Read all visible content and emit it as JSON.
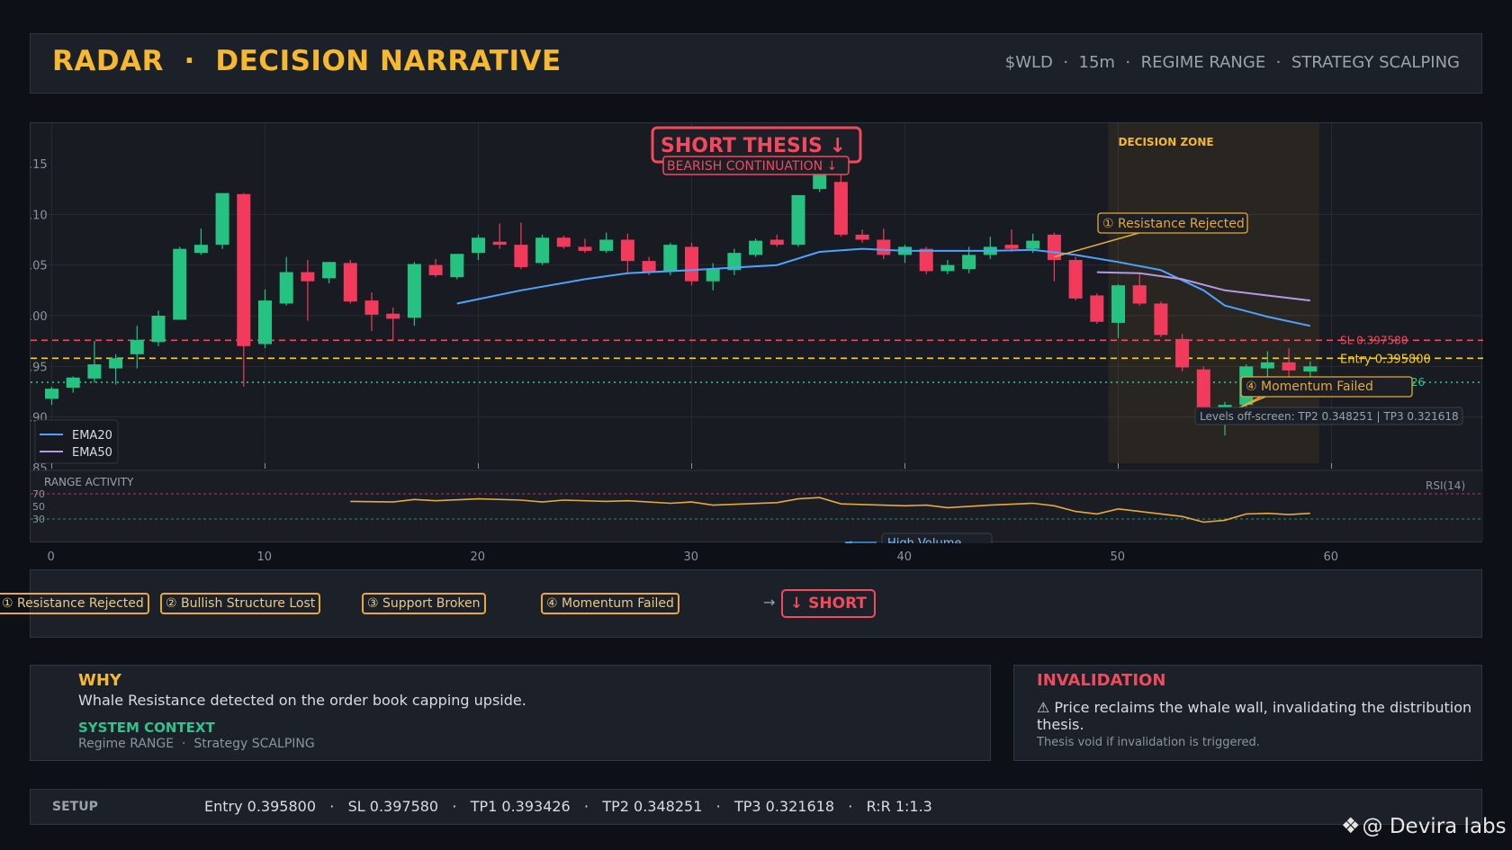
{
  "header": {
    "title": "RADAR  ·  DECISION NARRATIVE",
    "meta": "$WLD  ·  15m  ·  REGIME RANGE  ·  STRATEGY SCALPING"
  },
  "chart_data": {
    "type": "candlestick",
    "x_ticks": [
      "0",
      "10",
      "20",
      "30",
      "40",
      "50",
      "60"
    ],
    "y_ticks": [
      ".15",
      ".10",
      ".05",
      ".00",
      ".95",
      ".90",
      ".85"
    ],
    "candles": [
      [
        0.3918,
        0.3928,
        0.3912,
        0.393
      ],
      [
        0.3929,
        0.3939,
        0.3924,
        0.394
      ],
      [
        0.3938,
        0.3952,
        0.3934,
        0.3975
      ],
      [
        0.3948,
        0.3958,
        0.3932,
        0.3962
      ],
      [
        0.3962,
        0.3976,
        0.3948,
        0.399
      ],
      [
        0.3974,
        0.4,
        0.397,
        0.4005
      ],
      [
        0.3996,
        0.4066,
        0.3996,
        0.4068
      ],
      [
        0.4062,
        0.407,
        0.406,
        0.4086
      ],
      [
        0.407,
        0.4121,
        0.4066,
        0.4121
      ],
      [
        0.412,
        0.397,
        0.393,
        0.4121
      ],
      [
        0.3972,
        0.4015,
        0.3968,
        0.4026
      ],
      [
        0.4012,
        0.4043,
        0.401,
        0.4058
      ],
      [
        0.4043,
        0.4034,
        0.3995,
        0.4055
      ],
      [
        0.4037,
        0.4053,
        0.4032,
        0.4053
      ],
      [
        0.4052,
        0.4014,
        0.4012,
        0.4055
      ],
      [
        0.4015,
        0.4001,
        0.3985,
        0.4023
      ],
      [
        0.4002,
        0.3997,
        0.3975,
        0.4008
      ],
      [
        0.3998,
        0.4051,
        0.399,
        0.4053
      ],
      [
        0.405,
        0.404,
        0.4038,
        0.4056
      ],
      [
        0.4038,
        0.4061,
        0.4036,
        0.4061
      ],
      [
        0.4062,
        0.4077,
        0.4055,
        0.408
      ],
      [
        0.4073,
        0.407,
        0.4066,
        0.4091
      ],
      [
        0.407,
        0.4048,
        0.4046,
        0.4092
      ],
      [
        0.4052,
        0.4077,
        0.405,
        0.408
      ],
      [
        0.4077,
        0.4068,
        0.4066,
        0.4079
      ],
      [
        0.4068,
        0.4064,
        0.4062,
        0.4076
      ],
      [
        0.4064,
        0.4075,
        0.4062,
        0.4082
      ],
      [
        0.4075,
        0.4054,
        0.4041,
        0.4081
      ],
      [
        0.4054,
        0.4043,
        0.404,
        0.4058
      ],
      [
        0.4044,
        0.407,
        0.404,
        0.4072
      ],
      [
        0.4068,
        0.4034,
        0.403,
        0.4072
      ],
      [
        0.4034,
        0.4046,
        0.4025,
        0.4052
      ],
      [
        0.4045,
        0.4062,
        0.404,
        0.4066
      ],
      [
        0.406,
        0.4074,
        0.4058,
        0.4076
      ],
      [
        0.4075,
        0.407,
        0.4068,
        0.408
      ],
      [
        0.407,
        0.4119,
        0.4068,
        0.4119
      ],
      [
        0.4125,
        0.414,
        0.4122,
        0.415
      ],
      [
        0.4132,
        0.408,
        0.4078,
        0.4148
      ],
      [
        0.408,
        0.4075,
        0.4072,
        0.4085
      ],
      [
        0.4075,
        0.406,
        0.4056,
        0.4086
      ],
      [
        0.406,
        0.4068,
        0.4052,
        0.407
      ],
      [
        0.4066,
        0.4044,
        0.4041,
        0.4068
      ],
      [
        0.4044,
        0.405,
        0.4041,
        0.4055
      ],
      [
        0.4046,
        0.406,
        0.4042,
        0.4068
      ],
      [
        0.406,
        0.4068,
        0.4056,
        0.4078
      ],
      [
        0.407,
        0.4066,
        0.4063,
        0.4085
      ],
      [
        0.4066,
        0.4074,
        0.4062,
        0.4081
      ],
      [
        0.408,
        0.4055,
        0.4034,
        0.4082
      ],
      [
        0.4055,
        0.4017,
        0.4015,
        0.4058
      ],
      [
        0.402,
        0.3994,
        0.3992,
        0.4022
      ],
      [
        0.3993,
        0.403,
        0.3978,
        0.4031
      ],
      [
        0.403,
        0.4012,
        0.401,
        0.4042
      ],
      [
        0.4012,
        0.3981,
        0.3979,
        0.4014
      ],
      [
        0.3977,
        0.3949,
        0.3945,
        0.3982
      ],
      [
        0.3947,
        0.3905,
        0.3895,
        0.395
      ],
      [
        0.3905,
        0.3912,
        0.3882,
        0.3915
      ],
      [
        0.3912,
        0.395,
        0.391,
        0.3952
      ],
      [
        0.3948,
        0.3954,
        0.393,
        0.3965
      ],
      [
        0.3954,
        0.3946,
        0.3928,
        0.3968
      ],
      [
        0.3945,
        0.395,
        0.394,
        0.3955
      ]
    ],
    "ema20": [
      [
        19,
        0.4012
      ],
      [
        22,
        0.4025
      ],
      [
        25,
        0.4036
      ],
      [
        27,
        0.4042
      ],
      [
        30,
        0.4045
      ],
      [
        34,
        0.405
      ],
      [
        36,
        0.4063
      ],
      [
        38,
        0.4066
      ],
      [
        40,
        0.4064
      ],
      [
        44,
        0.4064
      ],
      [
        46,
        0.4065
      ],
      [
        48,
        0.406
      ],
      [
        50,
        0.4053
      ],
      [
        52,
        0.4045
      ],
      [
        54,
        0.4025
      ],
      [
        55,
        0.401
      ],
      [
        57,
        0.3999
      ],
      [
        59,
        0.399
      ]
    ],
    "ema50": [
      [
        49,
        0.4043
      ],
      [
        51,
        0.4042
      ],
      [
        53,
        0.4036
      ],
      [
        55,
        0.4025
      ],
      [
        57,
        0.402
      ],
      [
        59,
        0.4015
      ]
    ],
    "levels": [
      {
        "label": "SL 0.397580",
        "value": 0.39758,
        "color": "#f2495c",
        "style": "dashed"
      },
      {
        "label": "Entry 0.395800",
        "value": 0.3958,
        "color": "#f5d020",
        "style": "dashed"
      },
      {
        "label": "TP1 0.393426",
        "short_label": ".26",
        "value": 0.393426,
        "color": "#2ec48a",
        "style": "dotted"
      }
    ],
    "decision_zone": {
      "x_from": 50,
      "x_to": 59,
      "label": "DECISION ZONE"
    },
    "thesis": {
      "title": "SHORT THESIS  ↓",
      "subtitle": "BEARISH CONTINUATION ↓"
    },
    "annotations": [
      {
        "text": "① Resistance Rejected",
        "x": 47,
        "y": 0.4058
      },
      {
        "text": "④ Momentum Failed",
        "x": 54.5,
        "y": 0.3897
      }
    ],
    "offscreen_note": "Levels off-screen: TP2 0.348251 | TP3 0.321618",
    "legend": [
      "EMA20",
      "EMA50"
    ],
    "colors": {
      "up": "#26c281",
      "down": "#f23b5c",
      "ema20": "#4da3ff",
      "ema50": "#b399e6",
      "rsi": "#e6a93a"
    },
    "rsi": {
      "title": "RANGE ACTIVITY",
      "label": "RSI(14)",
      "levels": [
        "70",
        "50",
        "30"
      ],
      "values": [
        [
          14,
          58
        ],
        [
          16,
          57
        ],
        [
          17,
          61
        ],
        [
          18,
          59
        ],
        [
          20,
          62
        ],
        [
          22,
          60
        ],
        [
          23,
          57
        ],
        [
          24,
          60
        ],
        [
          26,
          58
        ],
        [
          27,
          59
        ],
        [
          29,
          55
        ],
        [
          30,
          57
        ],
        [
          31,
          52
        ],
        [
          34,
          56
        ],
        [
          35,
          62
        ],
        [
          36,
          64
        ],
        [
          37,
          54
        ],
        [
          40,
          51
        ],
        [
          41,
          52
        ],
        [
          42,
          48
        ],
        [
          44,
          52
        ],
        [
          46,
          55
        ],
        [
          47,
          51
        ],
        [
          48,
          42
        ],
        [
          49,
          38
        ],
        [
          50,
          46
        ],
        [
          51,
          42
        ],
        [
          53,
          34
        ],
        [
          54,
          25
        ],
        [
          55,
          28
        ],
        [
          56,
          38
        ],
        [
          57,
          39
        ],
        [
          58,
          37
        ],
        [
          59,
          39
        ]
      ],
      "volume_note": "High Volume"
    }
  },
  "flow": {
    "steps": [
      "① Resistance Rejected",
      "② Bullish Structure Lost",
      "③ Support Broken",
      "④ Momentum Failed"
    ],
    "arrow": "→",
    "result": "↓ SHORT"
  },
  "why": {
    "title": "WHY",
    "text": "Whale Resistance detected on the order book capping upside.",
    "ctx_title": "SYSTEM CONTEXT",
    "ctx_text": "Regime RANGE  ·  Strategy SCALPING"
  },
  "invalidation": {
    "title": "INVALIDATION",
    "text": "⚠ Price reclaims the whale wall, invalidating the distribution thesis.",
    "note": "Thesis void if invalidation is triggered."
  },
  "setup": {
    "label": "SETUP",
    "text": "Entry 0.395800   ·   SL 0.397580   ·   TP1 0.393426   ·   TP2 0.348251   ·   TP3 0.321618   ·   R:R 1:1.3"
  },
  "watermark": "@ Devira labs"
}
